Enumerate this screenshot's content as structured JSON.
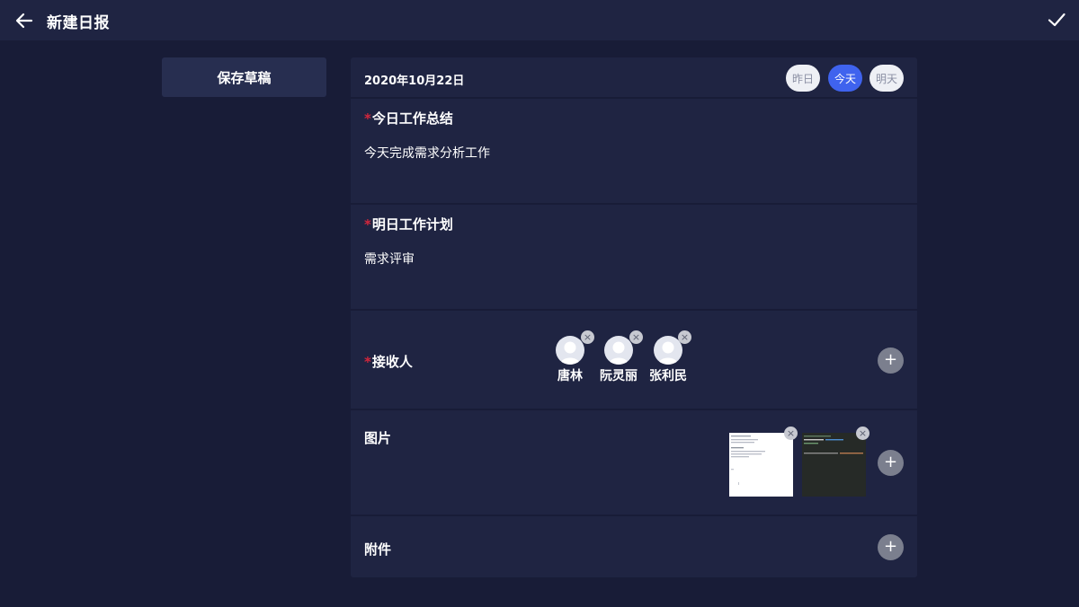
{
  "header": {
    "title": "新建日报",
    "back_icon": "arrow-left-icon",
    "confirm_icon": "checkmark-icon"
  },
  "sidebar": {
    "save_draft_label": "保存草稿"
  },
  "report": {
    "date": "2020年10月22日",
    "day_tabs": [
      {
        "label": "昨日",
        "active": false
      },
      {
        "label": "今天",
        "active": true
      },
      {
        "label": "明天",
        "active": false
      }
    ],
    "required_mark": "*",
    "today_summary": {
      "title": "今日工作总结",
      "value": "今天完成需求分析工作"
    },
    "tomorrow_plan": {
      "title": "明日工作计划",
      "value": "需求评审"
    },
    "recipients": {
      "title": "接收人",
      "items": [
        {
          "name": "唐林"
        },
        {
          "name": "阮灵丽"
        },
        {
          "name": "张利民"
        }
      ],
      "add_symbol": "+",
      "remove_symbol": "×"
    },
    "images": {
      "title": "图片",
      "count": 2
    },
    "attachments": {
      "title": "附件"
    }
  },
  "colors": {
    "background": "#181c37",
    "panel": "#1f2442",
    "accent": "#3f63ee",
    "required": "#d3263c"
  }
}
